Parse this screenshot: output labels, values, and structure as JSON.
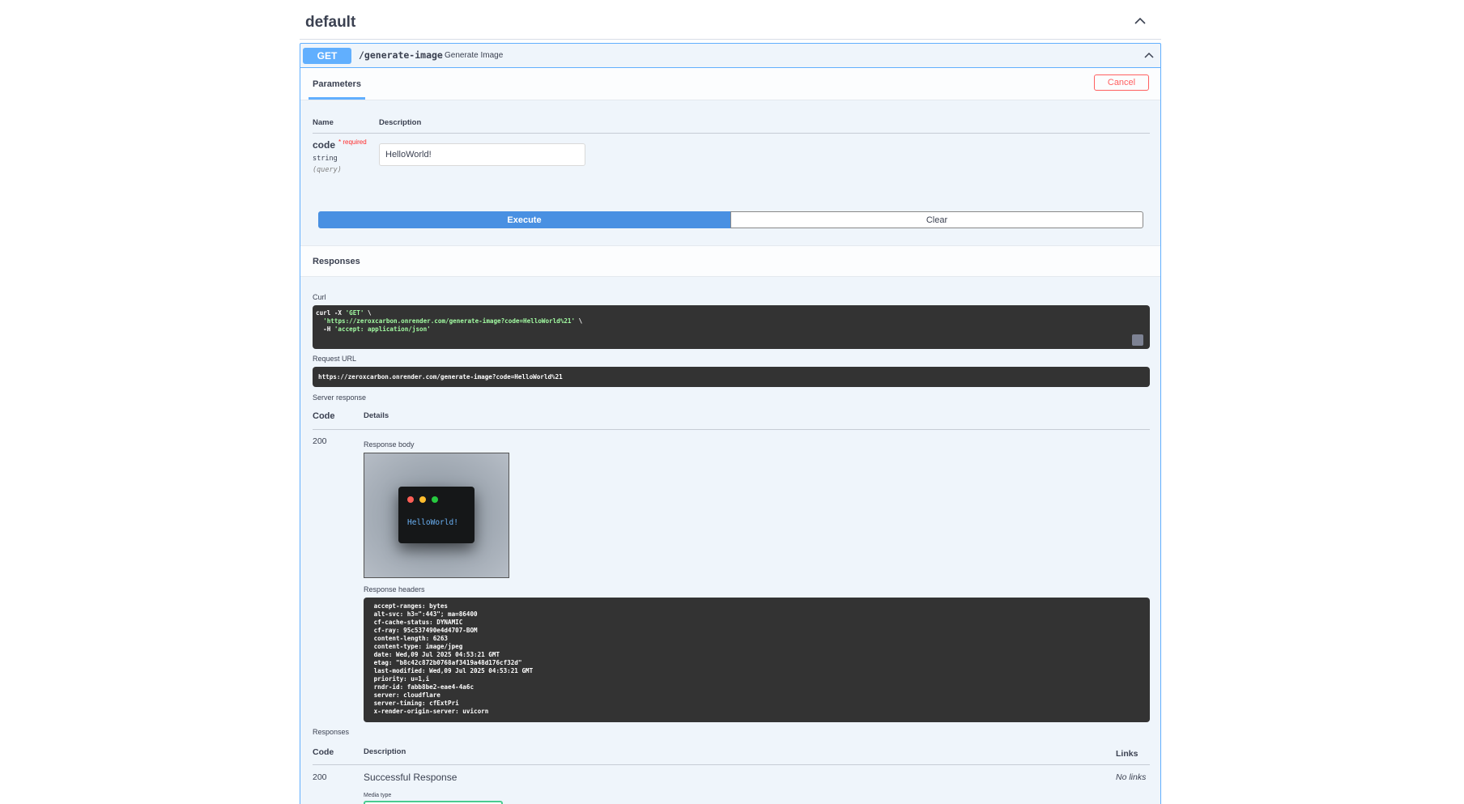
{
  "section": {
    "title": "default"
  },
  "operation": {
    "method": "GET",
    "path": "/generate-image",
    "summary": "Generate Image"
  },
  "parameters": {
    "tab_label": "Parameters",
    "cancel_label": "Cancel",
    "header_name": "Name",
    "header_description": "Description",
    "items": [
      {
        "name": "code",
        "required_label": "* required",
        "type": "string",
        "in": "(query)",
        "value": "HelloWorld!"
      }
    ]
  },
  "actions": {
    "execute_label": "Execute",
    "clear_label": "Clear"
  },
  "responses_section": {
    "title": "Responses"
  },
  "curl": {
    "label": "Curl",
    "line1_prefix": "curl -X ",
    "line1_method": "'GET'",
    "line1_suffix": " \\",
    "line2_url": "'https://zeroxcarbon.onrender.com/generate-image?code=HelloWorld%21'",
    "line2_suffix": " \\",
    "line3_prefix": "  -H ",
    "line3_header": "'accept: application/json'"
  },
  "request_url": {
    "label": "Request URL",
    "value": "https://zeroxcarbon.onrender.com/generate-image?code=HelloWorld%21"
  },
  "server_response": {
    "label": "Server response",
    "code_header": "Code",
    "details_header": "Details",
    "code": "200",
    "body_label": "Response body",
    "image_text": "HelloWorld!",
    "headers_label": "Response headers",
    "headers_text": " accept-ranges: bytes \n alt-svc: h3=\":443\"; ma=86400 \n cf-cache-status: DYNAMIC \n cf-ray: 95c537490e4d4707-BOM \n content-length: 6263 \n content-type: image/jpeg \n date: Wed,09 Jul 2025 04:53:21 GMT \n etag: \"b8c42c872b0768af3419a48d176cf32d\" \n last-modified: Wed,09 Jul 2025 04:53:21 GMT \n priority: u=1,i \n rndr-id: fabb8be2-eae4-4a6c \n server: cloudflare \n server-timing: cfExtPri \n x-render-origin-server: uvicorn "
  },
  "responses_table": {
    "title": "Responses",
    "code_header": "Code",
    "description_header": "Description",
    "links_header": "Links",
    "rows": [
      {
        "code": "200",
        "description": "Successful Response",
        "links": "No links",
        "media_type_label": "Media type"
      }
    ]
  },
  "colors": {
    "get_accent": "#61affe",
    "execute_blue": "#4990e2",
    "cancel_red": "#ff6060",
    "code_bg": "#333333"
  },
  "icons": {
    "section_toggle": "chevron-up-icon",
    "op_toggle": "chevron-up-icon",
    "copy": "clipboard-icon"
  }
}
